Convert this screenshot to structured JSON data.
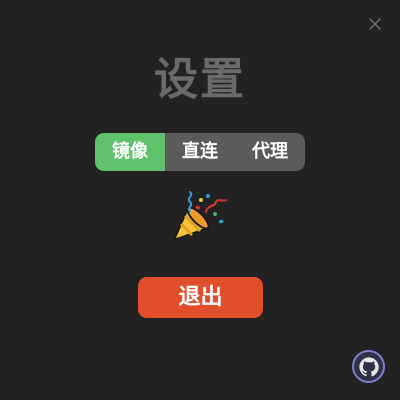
{
  "dialog": {
    "title": "设置",
    "close_icon": "close-icon"
  },
  "source_selector": {
    "selected": "镜像",
    "options": [
      {
        "label": "镜像",
        "active": true
      },
      {
        "label": "直连",
        "active": false
      },
      {
        "label": "代理",
        "active": false
      }
    ],
    "active_color": "#5fc36b"
  },
  "decoration": {
    "icon": "party-popper-icon"
  },
  "exit_button": {
    "label": "退出",
    "color": "#e14f2a"
  },
  "footer": {
    "github_icon": "github-icon"
  }
}
